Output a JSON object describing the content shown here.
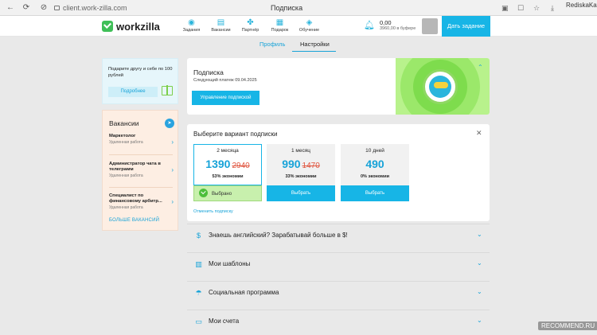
{
  "browser": {
    "url": "client.work-zilla.com",
    "tab_title": "Подписка",
    "user_name": "RediskaKat"
  },
  "header": {
    "logo": "workzilla",
    "nav": [
      {
        "label": "Задания",
        "icon": "tasks-icon"
      },
      {
        "label": "Вакансии",
        "icon": "vacancies-icon"
      },
      {
        "label": "Партнёр",
        "icon": "partner-icon"
      },
      {
        "label": "Подарок",
        "icon": "gift-icon"
      },
      {
        "label": "Обучение",
        "icon": "education-icon"
      }
    ],
    "balance": "0,00",
    "buffer": "3960,00 в буфере",
    "create_task": "Дать задание"
  },
  "subnav": {
    "profile": "Профиль",
    "settings": "Настройки"
  },
  "promo": {
    "text": "Подарите другу и себе по 100 рублей",
    "more": "Подробнее"
  },
  "vacancies": {
    "title": "Вакансии",
    "items": [
      {
        "title": "Маркетолог",
        "type": "Удаленная работа"
      },
      {
        "title": "Администратор чата в телеграмм",
        "type": "Удаленная работа"
      },
      {
        "title": "Специалист по финансовому арбитр...",
        "type": "Удаленная работа"
      }
    ],
    "more": "БОЛЬШЕ ВАКАНСИЙ"
  },
  "subscription": {
    "title": "Подписка",
    "next_payment": "Следующий платеж 09.04.2025",
    "manage": "Управление подпиской"
  },
  "options": {
    "title": "Выберите вариант подписки",
    "plans": [
      {
        "name": "2 месяца",
        "price": "1390",
        "old_price": "2940",
        "discount": "53% экономии",
        "button": "Выбрано",
        "selected": true
      },
      {
        "name": "1 месяц",
        "price": "990",
        "old_price": "1470",
        "discount": "33% экономии",
        "button": "Выбрать",
        "selected": false
      },
      {
        "name": "10 дней",
        "price": "490",
        "old_price": "",
        "discount": "0% экономии",
        "button": "Выбрать",
        "selected": false
      }
    ],
    "cancel": "Отменить подписку"
  },
  "accordion": [
    {
      "label": "Знаешь английский? Зарабатывай больше в $!",
      "icon": "dollar-icon"
    },
    {
      "label": "Мои шаблоны",
      "icon": "template-icon"
    },
    {
      "label": "Социальная программа",
      "icon": "social-icon"
    },
    {
      "label": "Мои счета",
      "icon": "wallet-icon"
    }
  ],
  "watermark": "RECOMMEND.RU"
}
